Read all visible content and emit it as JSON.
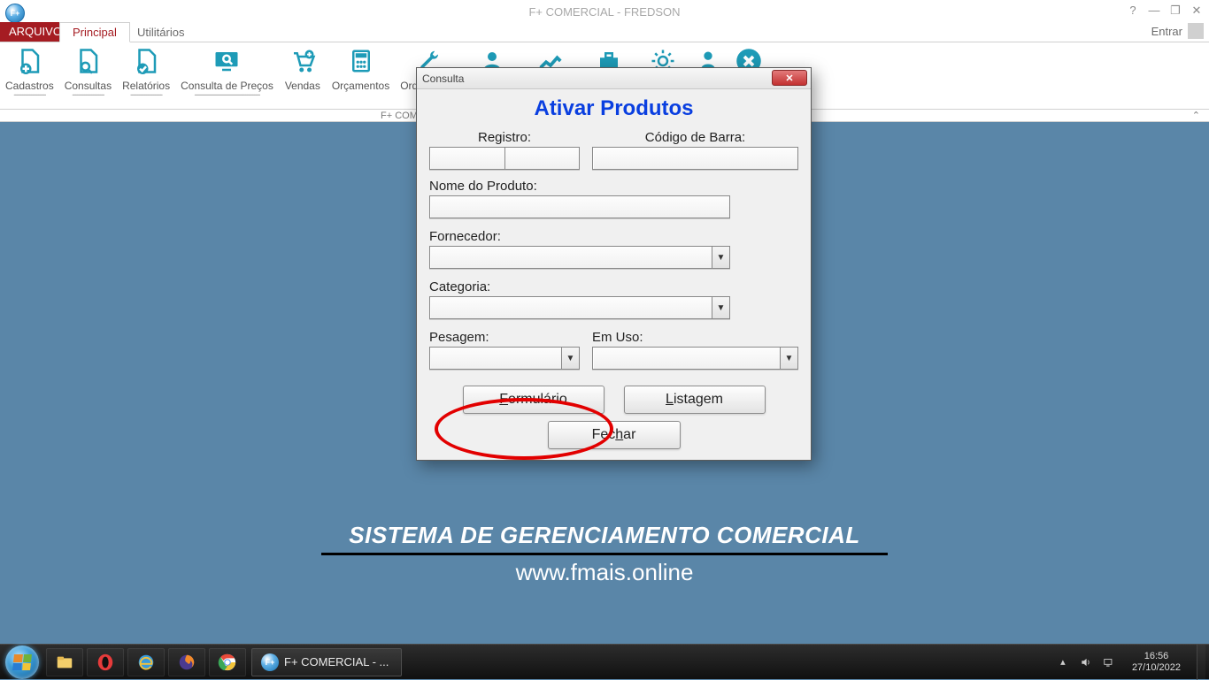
{
  "app": {
    "title": "F+ COMERCIAL - FREDSON",
    "subbar_left": "F+ COME",
    "login_label": "Entrar"
  },
  "tabs": {
    "file": "ARQUIVO",
    "principal": "Principal",
    "utilitarios": "Utilitários"
  },
  "ribbon": {
    "cadastros": "Cadastros",
    "consultas": "Consultas",
    "relatorios": "Relatórios",
    "consulta_precos": "Consulta de Preços",
    "vendas": "Vendas",
    "orcamentos": "Orçamentos",
    "ordem_servico": "Ordem de S"
  },
  "dialog": {
    "window_title": "Consulta",
    "heading": "Ativar Produtos",
    "labels": {
      "registro": "Registro:",
      "codigo_barra": "Código de Barra:",
      "nome_produto": "Nome do Produto:",
      "fornecedor": "Fornecedor:",
      "categoria": "Categoria:",
      "pesagem": "Pesagem:",
      "em_uso": "Em Uso:"
    },
    "buttons": {
      "formulario_pre": "F",
      "formulario_rest": "ormulário",
      "listagem_pre": "L",
      "listagem_rest": "istagem",
      "fechar_pre": "Fec",
      "fechar_mid": "h",
      "fechar_post": "ar"
    }
  },
  "banner": {
    "title": "SISTEMA DE GERENCIAMENTO COMERCIAL",
    "url": "www.fmais.online"
  },
  "taskbar": {
    "app_label": "F+ COMERCIAL - ...",
    "time": "16:56",
    "date": "27/10/2022"
  }
}
